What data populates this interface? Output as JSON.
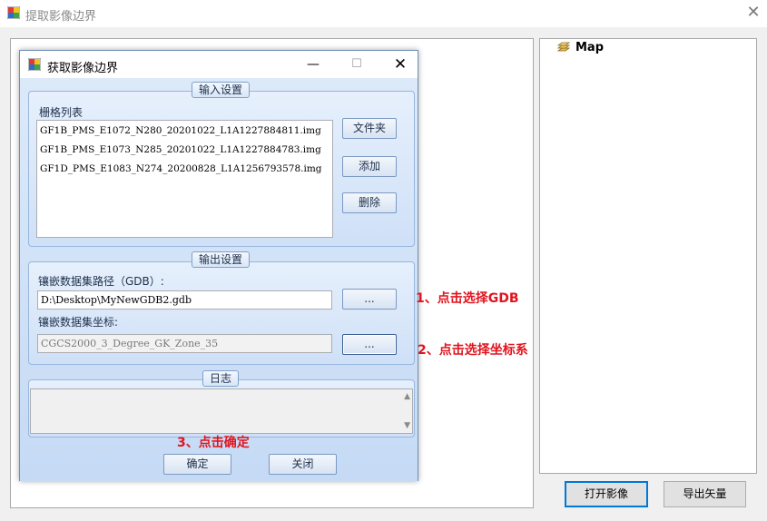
{
  "main_window": {
    "title": "提取影像边界",
    "close_glyph": "✕",
    "map_label": "Map",
    "open_image_label": "打开影像",
    "export_vector_label": "导出矢量"
  },
  "dialog": {
    "title": "获取影像边界",
    "min_glyph": "—",
    "max_glyph": "☐",
    "close_glyph": "✕",
    "input_group": {
      "label": "输入设置",
      "list_label": "栅格列表",
      "files": [
        "GF1B_PMS_E1072_N280_20201022_L1A1227884811.img",
        "GF1B_PMS_E1073_N285_20201022_L1A1227884783.img",
        "GF1D_PMS_E1083_N274_20200828_L1A1256793578.img"
      ],
      "folder_button": "文件夹",
      "add_button": "添加",
      "delete_button": "删除"
    },
    "output_group": {
      "label": "输出设置",
      "gdb_path_label": "镶嵌数据集路径（GDB）:",
      "gdb_path_value": "D:\\Desktop\\MyNewGDB2.gdb",
      "gdb_browse_button": "...",
      "coord_label": "镶嵌数据集坐标:",
      "coord_value": "CGCS2000_3_Degree_GK_Zone_35",
      "coord_browse_button": "..."
    },
    "log_group": {
      "label": "日志"
    },
    "ok_button": "确定",
    "close_button": "关闭"
  },
  "annotations": {
    "step1": "1、点击选择GDB",
    "step2": "2、点击选择坐标系",
    "step3": "3、点击确定",
    "color": "#e0141e"
  },
  "icons": {
    "app": "app-window-icon",
    "map": "layers-icon"
  }
}
